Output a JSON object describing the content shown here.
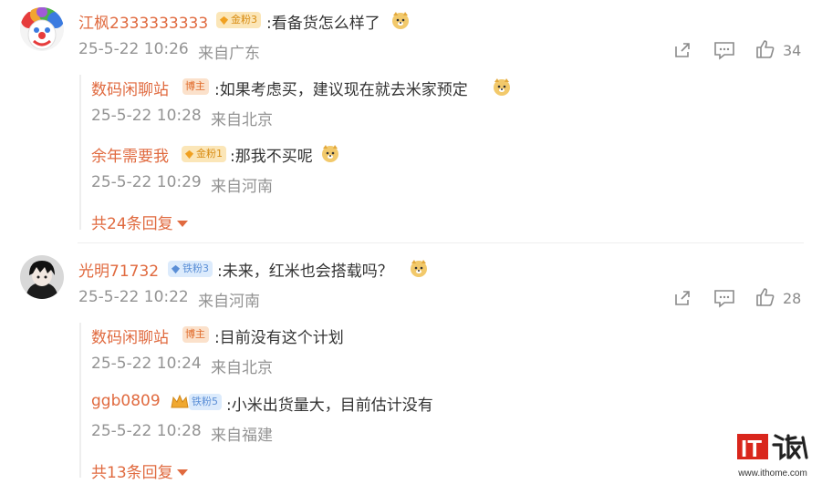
{
  "colors": {
    "accent": "#e06a3f",
    "muted": "#939393",
    "text": "#333333"
  },
  "comments": [
    {
      "user": "江枫2333333333",
      "badge": "金粉3",
      "text": ":看备货怎么样了",
      "time": "25-5-22 10:26",
      "location": "来自广东",
      "likes": "34",
      "replies": [
        {
          "user": "数码闲聊站",
          "badge": "博主",
          "text": ":如果考虑买，建议现在就去米家预定",
          "time": "25-5-22 10:28",
          "location": "来自北京"
        },
        {
          "user": "余年需要我",
          "badge": "金粉1",
          "text": ":那我不买呢",
          "time": "25-5-22 10:29",
          "location": "来自河南"
        }
      ],
      "more": "共24条回复"
    },
    {
      "user": "光明71732",
      "badge": "铁粉3",
      "text": ":未来，红米也会搭载吗？",
      "time": "25-5-22 10:22",
      "location": "来自河南",
      "likes": "28",
      "replies": [
        {
          "user": "数码闲聊站",
          "badge": "博主",
          "text": ":目前没有这个计划",
          "time": "25-5-22 10:24",
          "location": "来自北京"
        },
        {
          "user": "ggb0809",
          "badge": "铁粉5",
          "text": ":小米出货量大，目前估计没有",
          "time": "25-5-22 10:28",
          "location": "来自福建"
        }
      ],
      "more": "共13条回复"
    }
  ],
  "watermark": {
    "brand": "IT之家",
    "url": "www.ithome.com"
  },
  "icons": [
    "share-icon",
    "comment-icon",
    "like-icon",
    "emoji-icon",
    "medal-icon"
  ]
}
